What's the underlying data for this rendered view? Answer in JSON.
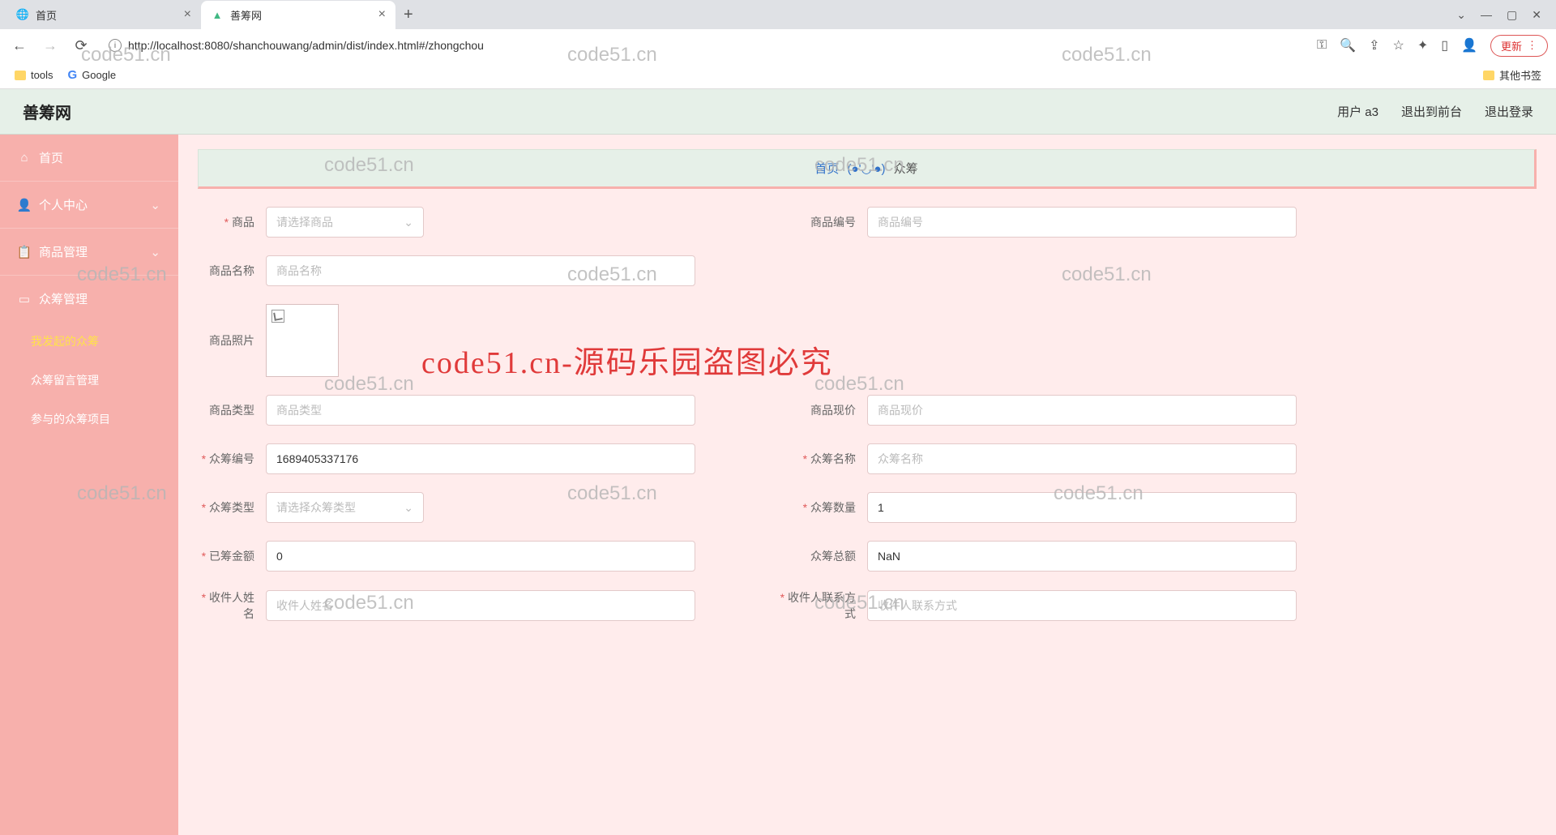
{
  "browser": {
    "tabs": [
      {
        "title": "首页",
        "active": false
      },
      {
        "title": "善筹网",
        "active": true
      }
    ],
    "url": "http://localhost:8080/shanchouwang/admin/dist/index.html#/zhongchou",
    "update_label": "更新",
    "bookmarks": {
      "tools": "tools",
      "google": "Google",
      "other": "其他书签"
    },
    "window": {
      "min": "—",
      "max": "▢",
      "close": "✕",
      "drop": "⌄"
    }
  },
  "header": {
    "title": "善筹网",
    "user_label": "用户 a3",
    "to_front": "退出到前台",
    "logout": "退出登录"
  },
  "sidebar": {
    "home": "首页",
    "personal": "个人中心",
    "goods": "商品管理",
    "crowd": "众筹管理",
    "subs": [
      "我发起的众筹",
      "众筹留言管理",
      "参与的众筹项目"
    ]
  },
  "breadcrumb": {
    "home": "首页",
    "face": "(●'◡'●)",
    "current": "众筹"
  },
  "form": {
    "labels": {
      "product": "商品",
      "product_id": "商品编号",
      "product_name": "商品名称",
      "product_photo": "商品照片",
      "product_type": "商品类型",
      "product_price": "商品现价",
      "crowd_id": "众筹编号",
      "crowd_name": "众筹名称",
      "crowd_type": "众筹类型",
      "crowd_qty": "众筹数量",
      "raised": "已筹金额",
      "total": "众筹总额",
      "recv_name": "收件人姓名",
      "recv_contact": "收件人联系方式"
    },
    "placeholders": {
      "product_select": "请选择商品",
      "product_id": "商品编号",
      "product_name": "商品名称",
      "product_type": "商品类型",
      "product_price": "商品现价",
      "crowd_name": "众筹名称",
      "crowd_type_select": "请选择众筹类型",
      "recv_name": "收件人姓名",
      "recv_contact": "收件人联系方式"
    },
    "values": {
      "crowd_id": "1689405337176",
      "crowd_qty": "1",
      "raised": "0",
      "total": "NaN"
    }
  },
  "watermarks": {
    "text": "code51.cn",
    "big": "code51.cn-源码乐园盗图必究"
  }
}
